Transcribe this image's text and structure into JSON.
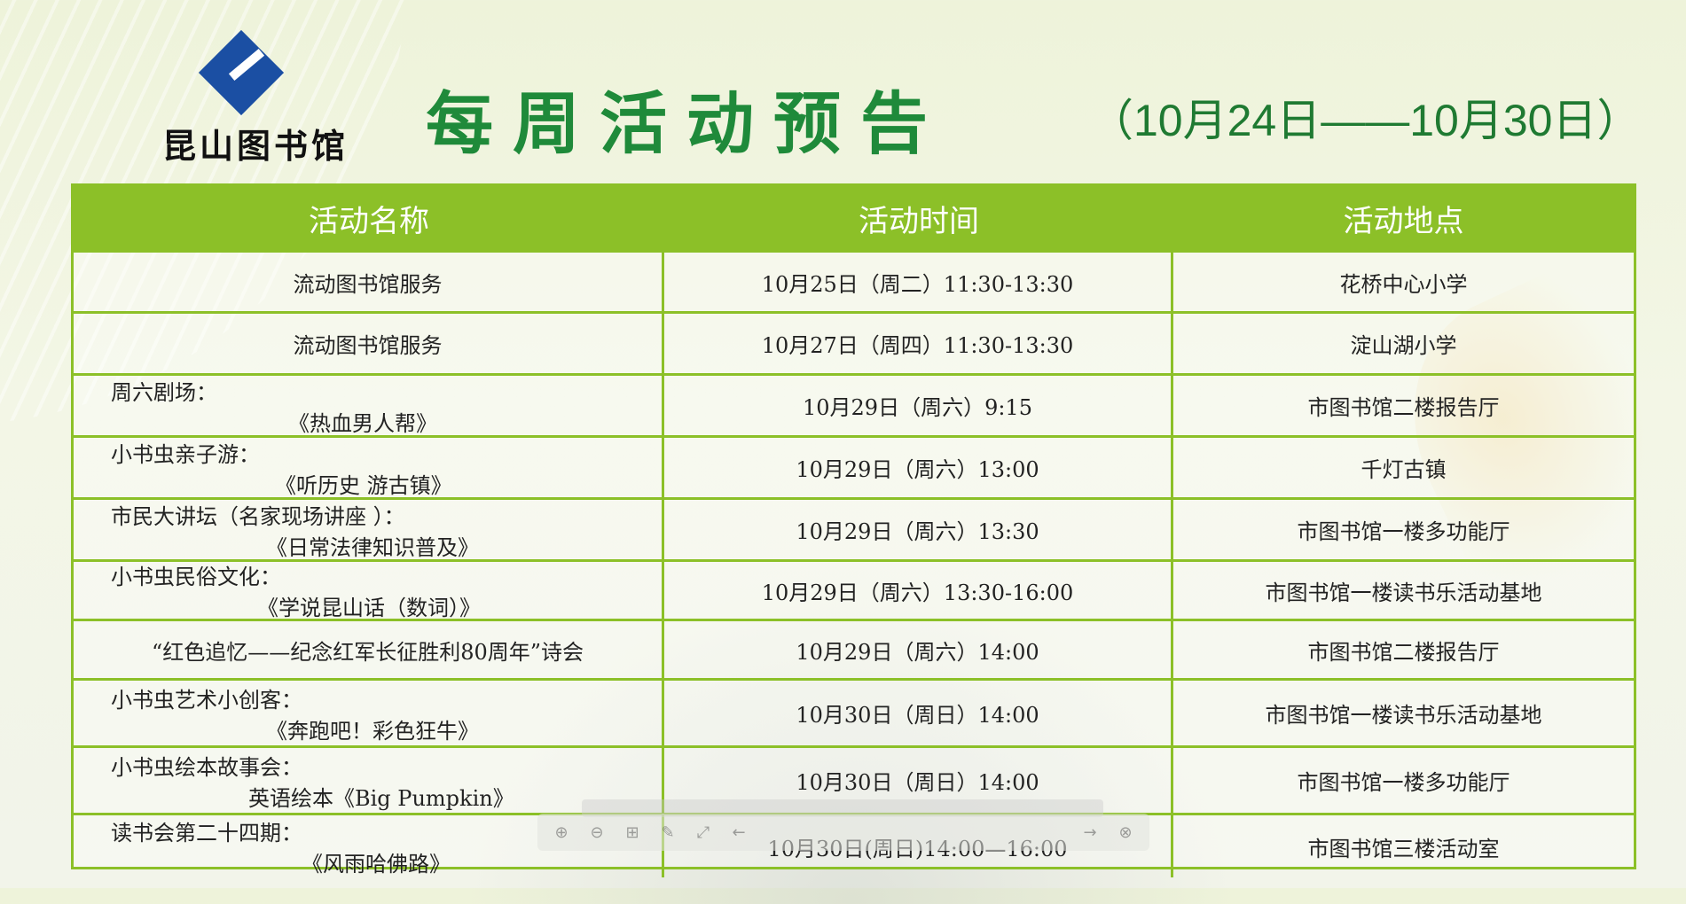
{
  "logo": {
    "text": "昆山图书馆",
    "icon": "library-logo-icon",
    "color": "#1b4fa3"
  },
  "header": {
    "title": "每周活动预告",
    "date_range": "（10月24日——10月30日）"
  },
  "colors": {
    "accent": "#8cc028",
    "title": "#1f8a3a"
  },
  "table": {
    "headers": [
      "活动名称",
      "活动时间",
      "活动地点"
    ],
    "rows": [
      {
        "name_line1": "流动图书馆服务",
        "name_line2": "",
        "time": "10月25日（周二）11:30-13:30",
        "place": "花桥中心小学"
      },
      {
        "name_line1": "流动图书馆服务",
        "name_line2": "",
        "time": "10月27日（周四）11:30-13:30",
        "place": "淀山湖小学"
      },
      {
        "name_line1": "周六剧场：",
        "name_line2": "《热血男人帮》",
        "time": "10月29日（周六）9:15",
        "place": "市图书馆二楼报告厅"
      },
      {
        "name_line1": "小书虫亲子游：",
        "name_line2": "《听历史 游古镇》",
        "time": "10月29日（周六）13:00",
        "place": "千灯古镇"
      },
      {
        "name_line1": "市民大讲坛（名家现场讲座 ）：",
        "name_line2": "《日常法律知识普及》",
        "time": "10月29日（周六）13:30",
        "place": "市图书馆一楼多功能厅"
      },
      {
        "name_line1": "小书虫民俗文化：",
        "name_line2": "《学说昆山话（数词）》",
        "time": "10月29日（周六）13:30-16:00",
        "place": "市图书馆一楼读书乐活动基地"
      },
      {
        "name_line1": "“红色追忆——纪念红军长征胜利80周年”诗会",
        "name_line2": "",
        "time": "10月29日（周六）14:00",
        "place": "市图书馆二楼报告厅"
      },
      {
        "name_line1": "小书虫艺术小创客：",
        "name_line2": "《奔跑吧！彩色狂牛》",
        "time": "10月30日（周日）14:00",
        "place": "市图书馆一楼读书乐活动基地"
      },
      {
        "name_line1": "小书虫绘本故事会：",
        "name_line2": "英语绘本《Big Pumpkin》",
        "time": "10月30日（周日）14:00",
        "place": "市图书馆一楼多功能厅"
      },
      {
        "name_line1": "读书会第二十四期：",
        "name_line2": "《风雨哈佛路》",
        "time": "10月30日(周日)14:00—16:00",
        "place": "市图书馆三楼活动室"
      }
    ]
  },
  "viewer_toolbar": {
    "icons": [
      "zoom-in-icon",
      "zoom-out-icon",
      "fit-icon",
      "edit-icon",
      "fullscreen-icon",
      "prev-arrow-icon",
      "next-arrow-icon",
      "close-circle-icon"
    ]
  }
}
